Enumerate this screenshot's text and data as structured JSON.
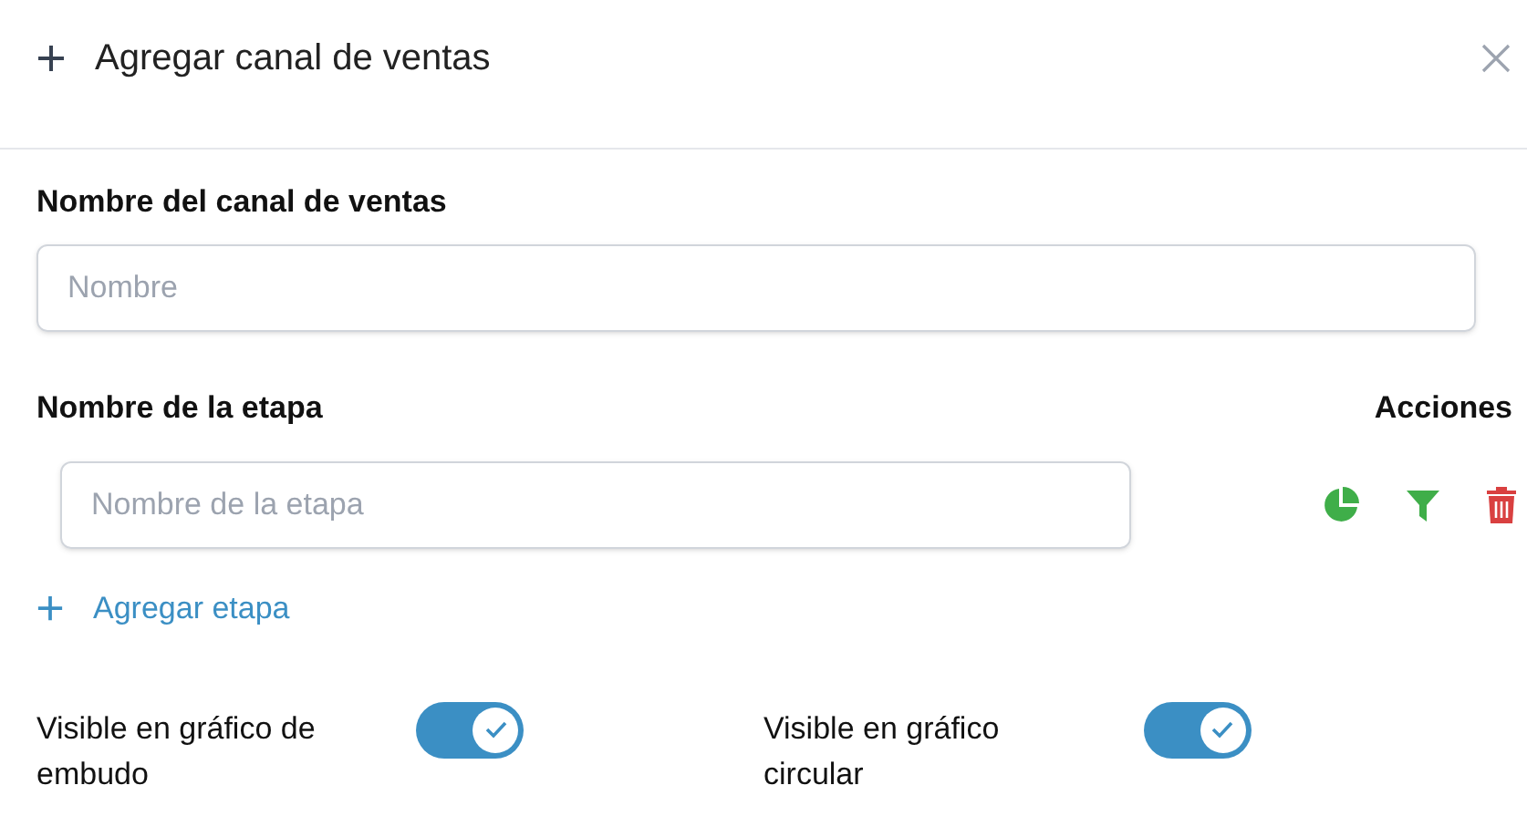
{
  "dialog": {
    "title": "Agregar canal de ventas"
  },
  "channel_name": {
    "label": "Nombre del canal de ventas",
    "placeholder": "Nombre"
  },
  "stages": {
    "label": "Nombre de la etapa",
    "actions_label": "Acciones",
    "rows": [
      {
        "placeholder": "Nombre de la etapa"
      }
    ],
    "add_link": "Agregar etapa"
  },
  "toggles": [
    {
      "label": "Visible en gráfico de embudo",
      "on": true
    },
    {
      "label": "Visible en gráfico circular",
      "on": true
    }
  ]
}
